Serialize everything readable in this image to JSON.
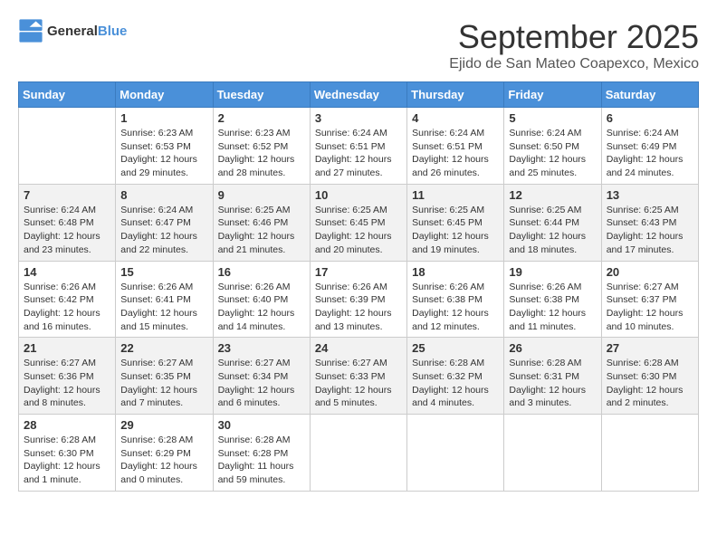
{
  "header": {
    "logo_general": "General",
    "logo_blue": "Blue",
    "month": "September 2025",
    "location": "Ejido de San Mateo Coapexco, Mexico"
  },
  "days_of_week": [
    "Sunday",
    "Monday",
    "Tuesday",
    "Wednesday",
    "Thursday",
    "Friday",
    "Saturday"
  ],
  "weeks": [
    [
      {
        "day": "",
        "detail": ""
      },
      {
        "day": "1",
        "detail": "Sunrise: 6:23 AM\nSunset: 6:53 PM\nDaylight: 12 hours\nand 29 minutes."
      },
      {
        "day": "2",
        "detail": "Sunrise: 6:23 AM\nSunset: 6:52 PM\nDaylight: 12 hours\nand 28 minutes."
      },
      {
        "day": "3",
        "detail": "Sunrise: 6:24 AM\nSunset: 6:51 PM\nDaylight: 12 hours\nand 27 minutes."
      },
      {
        "day": "4",
        "detail": "Sunrise: 6:24 AM\nSunset: 6:51 PM\nDaylight: 12 hours\nand 26 minutes."
      },
      {
        "day": "5",
        "detail": "Sunrise: 6:24 AM\nSunset: 6:50 PM\nDaylight: 12 hours\nand 25 minutes."
      },
      {
        "day": "6",
        "detail": "Sunrise: 6:24 AM\nSunset: 6:49 PM\nDaylight: 12 hours\nand 24 minutes."
      }
    ],
    [
      {
        "day": "7",
        "detail": "Sunrise: 6:24 AM\nSunset: 6:48 PM\nDaylight: 12 hours\nand 23 minutes."
      },
      {
        "day": "8",
        "detail": "Sunrise: 6:24 AM\nSunset: 6:47 PM\nDaylight: 12 hours\nand 22 minutes."
      },
      {
        "day": "9",
        "detail": "Sunrise: 6:25 AM\nSunset: 6:46 PM\nDaylight: 12 hours\nand 21 minutes."
      },
      {
        "day": "10",
        "detail": "Sunrise: 6:25 AM\nSunset: 6:45 PM\nDaylight: 12 hours\nand 20 minutes."
      },
      {
        "day": "11",
        "detail": "Sunrise: 6:25 AM\nSunset: 6:45 PM\nDaylight: 12 hours\nand 19 minutes."
      },
      {
        "day": "12",
        "detail": "Sunrise: 6:25 AM\nSunset: 6:44 PM\nDaylight: 12 hours\nand 18 minutes."
      },
      {
        "day": "13",
        "detail": "Sunrise: 6:25 AM\nSunset: 6:43 PM\nDaylight: 12 hours\nand 17 minutes."
      }
    ],
    [
      {
        "day": "14",
        "detail": "Sunrise: 6:26 AM\nSunset: 6:42 PM\nDaylight: 12 hours\nand 16 minutes."
      },
      {
        "day": "15",
        "detail": "Sunrise: 6:26 AM\nSunset: 6:41 PM\nDaylight: 12 hours\nand 15 minutes."
      },
      {
        "day": "16",
        "detail": "Sunrise: 6:26 AM\nSunset: 6:40 PM\nDaylight: 12 hours\nand 14 minutes."
      },
      {
        "day": "17",
        "detail": "Sunrise: 6:26 AM\nSunset: 6:39 PM\nDaylight: 12 hours\nand 13 minutes."
      },
      {
        "day": "18",
        "detail": "Sunrise: 6:26 AM\nSunset: 6:38 PM\nDaylight: 12 hours\nand 12 minutes."
      },
      {
        "day": "19",
        "detail": "Sunrise: 6:26 AM\nSunset: 6:38 PM\nDaylight: 12 hours\nand 11 minutes."
      },
      {
        "day": "20",
        "detail": "Sunrise: 6:27 AM\nSunset: 6:37 PM\nDaylight: 12 hours\nand 10 minutes."
      }
    ],
    [
      {
        "day": "21",
        "detail": "Sunrise: 6:27 AM\nSunset: 6:36 PM\nDaylight: 12 hours\nand 8 minutes."
      },
      {
        "day": "22",
        "detail": "Sunrise: 6:27 AM\nSunset: 6:35 PM\nDaylight: 12 hours\nand 7 minutes."
      },
      {
        "day": "23",
        "detail": "Sunrise: 6:27 AM\nSunset: 6:34 PM\nDaylight: 12 hours\nand 6 minutes."
      },
      {
        "day": "24",
        "detail": "Sunrise: 6:27 AM\nSunset: 6:33 PM\nDaylight: 12 hours\nand 5 minutes."
      },
      {
        "day": "25",
        "detail": "Sunrise: 6:28 AM\nSunset: 6:32 PM\nDaylight: 12 hours\nand 4 minutes."
      },
      {
        "day": "26",
        "detail": "Sunrise: 6:28 AM\nSunset: 6:31 PM\nDaylight: 12 hours\nand 3 minutes."
      },
      {
        "day": "27",
        "detail": "Sunrise: 6:28 AM\nSunset: 6:30 PM\nDaylight: 12 hours\nand 2 minutes."
      }
    ],
    [
      {
        "day": "28",
        "detail": "Sunrise: 6:28 AM\nSunset: 6:30 PM\nDaylight: 12 hours\nand 1 minute."
      },
      {
        "day": "29",
        "detail": "Sunrise: 6:28 AM\nSunset: 6:29 PM\nDaylight: 12 hours\nand 0 minutes."
      },
      {
        "day": "30",
        "detail": "Sunrise: 6:28 AM\nSunset: 6:28 PM\nDaylight: 11 hours\nand 59 minutes."
      },
      {
        "day": "",
        "detail": ""
      },
      {
        "day": "",
        "detail": ""
      },
      {
        "day": "",
        "detail": ""
      },
      {
        "day": "",
        "detail": ""
      }
    ]
  ]
}
